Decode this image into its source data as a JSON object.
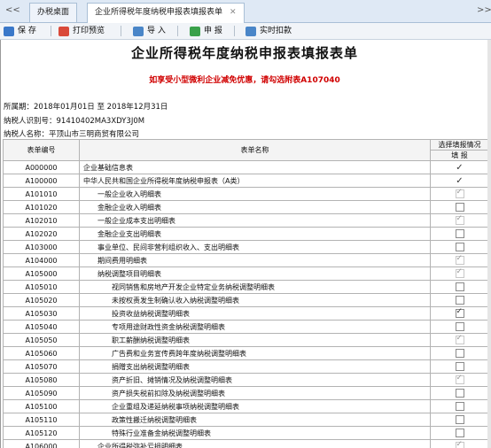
{
  "tabs": {
    "home": "办税桌面",
    "current": "企业所得税年度纳税申报表填报表单"
  },
  "toolbar": {
    "save": "保 存",
    "print": "打印预览",
    "import": "导 入",
    "declare": "申 报",
    "deduct": "实时扣款"
  },
  "form": {
    "title": "企业所得税年度纳税申报表填报表单",
    "notice": "如享受小型微利企业减免优惠，请勾选附表A107040",
    "period": "所属期：2018年01月01日 至 2018年12月31日",
    "taxpayer_id": "纳税人识别号：91410402MA3XDY3J0M",
    "taxpayer_name": "纳税人名称：平顶山市三明商贸有限公司"
  },
  "table": {
    "col_code": "表单编号",
    "col_name": "表单名称",
    "col_select": "选择填报情况",
    "col_fill": "填 报",
    "rows": [
      {
        "code": "A000000",
        "name": "企业基础信息表",
        "indent": 0,
        "sel": "tick"
      },
      {
        "code": "A100000",
        "name": "中华人民共和国企业所得税年度纳税申报表（A类）",
        "indent": 0,
        "sel": "tick"
      },
      {
        "code": "A101010",
        "name": "一般企业收入明细表",
        "indent": 1,
        "sel": "dis-on"
      },
      {
        "code": "A101020",
        "name": "金融企业收入明细表",
        "indent": 1,
        "sel": "off"
      },
      {
        "code": "A102010",
        "name": "一般企业成本支出明细表",
        "indent": 1,
        "sel": "dis-on"
      },
      {
        "code": "A102020",
        "name": "金融企业支出明细表",
        "indent": 1,
        "sel": "off"
      },
      {
        "code": "A103000",
        "name": "事业单位、民间非营利组织收入、支出明细表",
        "indent": 1,
        "sel": "off"
      },
      {
        "code": "A104000",
        "name": "期间费用明细表",
        "indent": 1,
        "sel": "dis-on"
      },
      {
        "code": "A105000",
        "name": "纳税调整项目明细表",
        "indent": 1,
        "sel": "dis-on"
      },
      {
        "code": "A105010",
        "name": "视同销售和房地产开发企业特定业务纳税调整明细表",
        "indent": 2,
        "sel": "off"
      },
      {
        "code": "A105020",
        "name": "未按权责发生制确认收入纳税调整明细表",
        "indent": 2,
        "sel": "off"
      },
      {
        "code": "A105030",
        "name": "投资收益纳税调整明细表",
        "indent": 2,
        "sel": "on"
      },
      {
        "code": "A105040",
        "name": "专项用途财政性资金纳税调整明细表",
        "indent": 2,
        "sel": "off"
      },
      {
        "code": "A105050",
        "name": "职工薪酬纳税调整明细表",
        "indent": 2,
        "sel": "dis-on"
      },
      {
        "code": "A105060",
        "name": "广告费和业务宣传费跨年度纳税调整明细表",
        "indent": 2,
        "sel": "off"
      },
      {
        "code": "A105070",
        "name": "捐赠支出纳税调整明细表",
        "indent": 2,
        "sel": "off"
      },
      {
        "code": "A105080",
        "name": "资产折旧、摊销情况及纳税调整明细表",
        "indent": 2,
        "sel": "dis-on"
      },
      {
        "code": "A105090",
        "name": "资产损失税前扣除及纳税调整明细表",
        "indent": 2,
        "sel": "off"
      },
      {
        "code": "A105100",
        "name": "企业重组及递延纳税事项纳税调整明细表",
        "indent": 2,
        "sel": "off"
      },
      {
        "code": "A105110",
        "name": "政策性搬迁纳税调整明细表",
        "indent": 2,
        "sel": "off"
      },
      {
        "code": "A105120",
        "name": "特殊行业准备金纳税调整明细表",
        "indent": 2,
        "sel": "off"
      },
      {
        "code": "A106000",
        "name": "企业所得税弥补亏损明细表",
        "indent": 1,
        "sel": "dis-on"
      }
    ]
  }
}
